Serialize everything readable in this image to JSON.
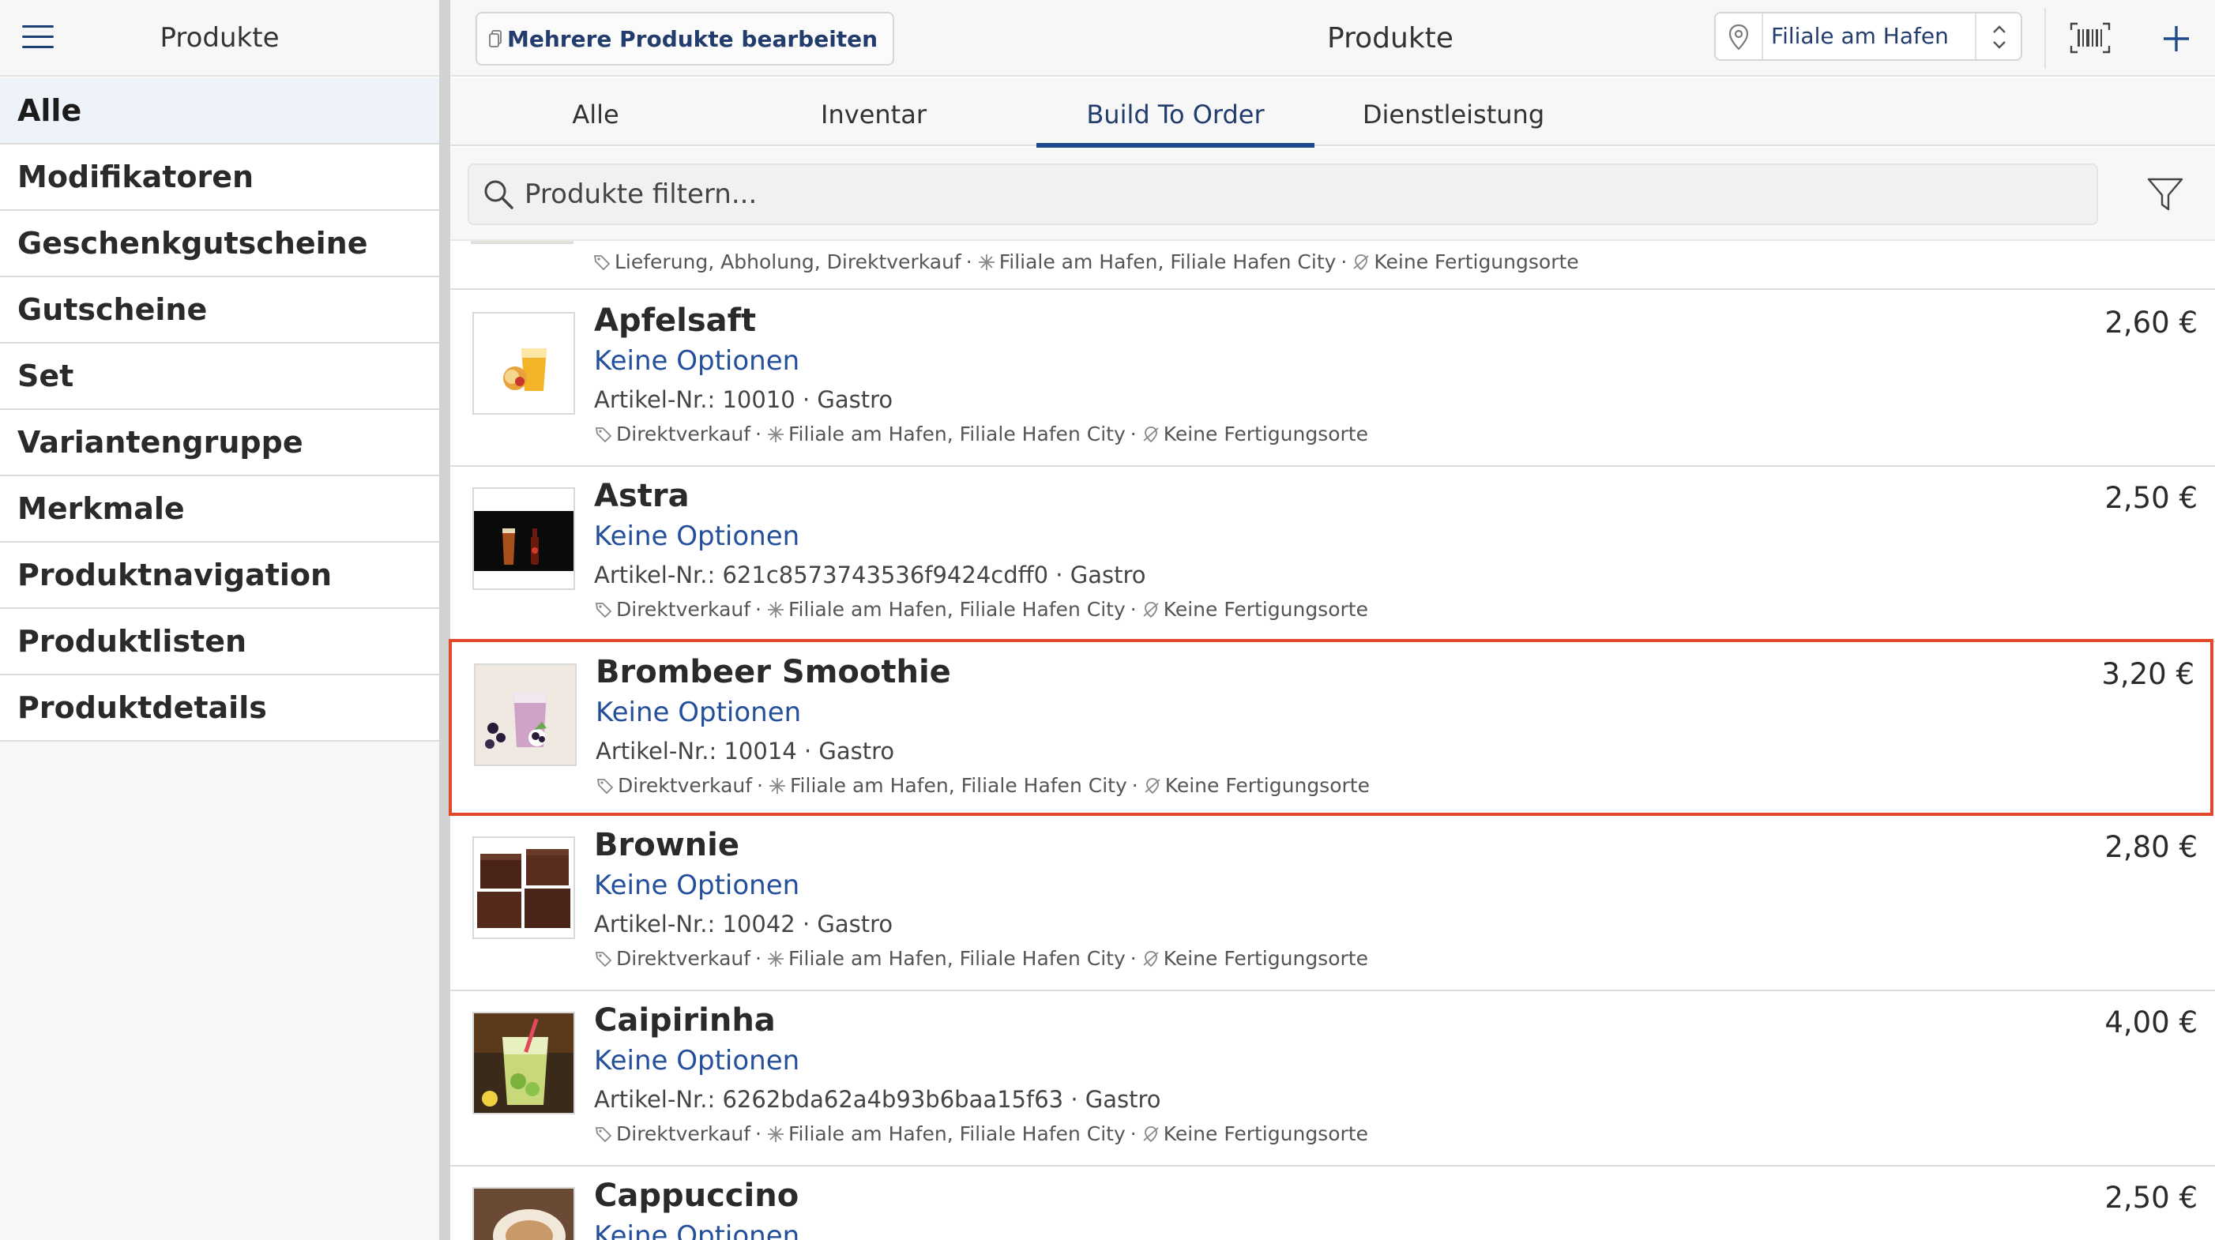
{
  "sidebar": {
    "title": "Produkte",
    "items": [
      {
        "label": "Alle"
      },
      {
        "label": "Modifikatoren"
      },
      {
        "label": "Geschenkgutscheine"
      },
      {
        "label": "Gutscheine"
      },
      {
        "label": "Set"
      },
      {
        "label": "Variantengruppe"
      },
      {
        "label": "Merkmale"
      },
      {
        "label": "Produktnavigation"
      },
      {
        "label": "Produktlisten"
      },
      {
        "label": "Produktdetails"
      }
    ],
    "active_index": 0
  },
  "header": {
    "bulk_edit_label": "Mehrere Produkte bearbeiten",
    "title": "Produkte",
    "branch": "Filiale am Hafen"
  },
  "tabs": [
    {
      "label": "Alle"
    },
    {
      "label": "Inventar"
    },
    {
      "label": "Build To Order"
    },
    {
      "label": "Dienstleistung"
    }
  ],
  "active_tab": 2,
  "search": {
    "placeholder": "Produkte filtern..."
  },
  "partial_row": {
    "channels": "Lieferung, Abholung, Direktverkauf",
    "branches": "Filiale am Hafen, Filiale Hafen City",
    "production": "Keine Fertigungsorte"
  },
  "products": [
    {
      "name": "Apfelsaft",
      "options": "Keine Optionen",
      "sku": "Artikel-Nr.: 10010 · Gastro",
      "channels": "Direktverkauf",
      "branches": "Filiale am Hafen, Filiale Hafen City",
      "production": "Keine Fertigungsorte",
      "price": "2,60 €"
    },
    {
      "name": "Astra",
      "options": "Keine Optionen",
      "sku": "Artikel-Nr.: 621c8573743536f9424cdff0 · Gastro",
      "channels": "Direktverkauf",
      "branches": "Filiale am Hafen, Filiale Hafen City",
      "production": "Keine Fertigungsorte",
      "price": "2,50 €"
    },
    {
      "name": "Brombeer Smoothie",
      "options": "Keine Optionen",
      "sku": "Artikel-Nr.: 10014 · Gastro",
      "channels": "Direktverkauf",
      "branches": "Filiale am Hafen, Filiale Hafen City",
      "production": "Keine Fertigungsorte",
      "price": "3,20 €"
    },
    {
      "name": "Brownie",
      "options": "Keine Optionen",
      "sku": "Artikel-Nr.: 10042 · Gastro",
      "channels": "Direktverkauf",
      "branches": "Filiale am Hafen, Filiale Hafen City",
      "production": "Keine Fertigungsorte",
      "price": "2,80 €"
    },
    {
      "name": "Caipirinha",
      "options": "Keine Optionen",
      "sku": "Artikel-Nr.: 6262bda62a4b93b6baa15f63 · Gastro",
      "channels": "Direktverkauf",
      "branches": "Filiale am Hafen, Filiale Hafen City",
      "production": "Keine Fertigungsorte",
      "price": "4,00 €"
    },
    {
      "name": "Cappuccino",
      "options": "Keine Optionen",
      "sku": "",
      "channels": "",
      "branches": "",
      "production": "",
      "price": "2,50 €"
    }
  ],
  "selected_product_index": 2,
  "colors": {
    "accent": "#1f4a8e",
    "link": "#244f9a",
    "selection": "#e04a2b"
  }
}
